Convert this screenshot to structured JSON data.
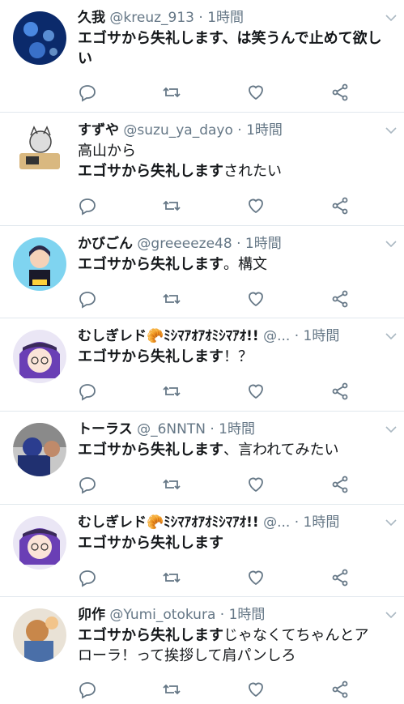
{
  "icons": {
    "reply": "reply-icon",
    "retweet": "retweet-icon",
    "like": "heart-icon",
    "share": "share-icon",
    "more": "chevron-down-icon"
  },
  "colors": {
    "text": "#14171a",
    "secondary": "#657786",
    "divider": "#e1e8ed"
  },
  "tweets": [
    {
      "name": "久我",
      "handle": "@kreuz_913",
      "sep": "·",
      "time": "1時間",
      "bold": "エゴサから失礼します、は笑うんで止めて欲しい",
      "rest": ""
    },
    {
      "name": "すずや",
      "handle": "@suzu_ya_dayo",
      "sep": "·",
      "time": "1時間",
      "pre": "高山から",
      "bold": "エゴサから失礼します",
      "rest": "されたい"
    },
    {
      "name": "かびごん",
      "handle": "@greeeeze48",
      "sep": "·",
      "time": "1時間",
      "bold": "エゴサから失礼します",
      "rest": "。構文"
    },
    {
      "name": "むしぎレド🥐ﾐｼﾏｱｵｱｵﾐｼﾏｱｵ!!",
      "handle": "@...",
      "sep": "·",
      "time": "1時間",
      "bold": "エゴサから失礼します",
      "rest": "！？"
    },
    {
      "name": "トーラス",
      "handle": "@_6NNTN",
      "sep": "·",
      "time": "1時間",
      "bold": "エゴサから失礼します",
      "rest": "、言われてみたい"
    },
    {
      "name": "むしぎレド🥐ﾐｼﾏｱｵｱｵﾐｼﾏｱｵ!!",
      "handle": "@...",
      "sep": "·",
      "time": "1時間",
      "bold": "エゴサから失礼します",
      "rest": ""
    },
    {
      "name": "卯作",
      "handle": "@Yumi_otokura",
      "sep": "·",
      "time": "1時間",
      "bold": "エゴサから失礼します",
      "rest": "じゃなくてちゃんとアローラ！って挨拶して肩パンしろ"
    }
  ]
}
